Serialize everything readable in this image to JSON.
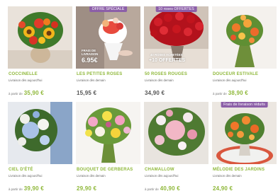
{
  "products": [
    {
      "name": "COCCINELLE",
      "delivery": "Livraison dès aujourd'hui",
      "price_prefix": "à partir de",
      "price": "35,90 €",
      "badge": "",
      "icon": "bouquet-sunflower-photo"
    },
    {
      "name": "LES PETITES ROSES",
      "delivery": "Livraison dès demain",
      "price_prefix": "",
      "price": "15,95 €",
      "badge": "OFFRE SPÉCIALE",
      "overlay_line1": "FRAIS DE",
      "overlay_line2": "LIVRAISON",
      "overlay_big": "6.95€",
      "icon": "bouquet-small-roses-photo"
    },
    {
      "name": "50 ROSES ROUGES",
      "delivery": "Livraison dès demain",
      "price_prefix": "",
      "price": "34,90 €",
      "badge": "10 roses OFFERTES",
      "overlay_line1": "40 ROSES ACHETÉES",
      "overlay_big": "+10 OFFERTES",
      "icon": "bouquet-red-roses-photo"
    },
    {
      "name": "DOUCEUR ESTIVALE",
      "delivery": "Livraison dès aujourd'hui",
      "price_prefix": "à partir de",
      "price": "38,90 €",
      "badge": "",
      "icon": "bouquet-summer-photo"
    },
    {
      "name": "CIEL D'ÉTÉ",
      "delivery": "Livraison dès aujourd'hui",
      "price_prefix": "à partir de",
      "price": "39,90 €",
      "badge": "",
      "icon": "bouquet-blue-hydrangea-photo"
    },
    {
      "name": "BOUQUET DE GERBERAS",
      "delivery": "Livraison dès demain",
      "price_prefix": "",
      "price": "29,90 €",
      "badge": "",
      "icon": "bouquet-gerbera-photo"
    },
    {
      "name": "CHAMALLOW",
      "delivery": "Livraison dès aujourd'hui",
      "price_prefix": "à partir de",
      "price": "40,90 €",
      "badge": "",
      "icon": "bouquet-pink-photo"
    },
    {
      "name": "MÉLODIE DES JARDINS",
      "delivery": "Livraison dès demain",
      "price_prefix": "",
      "price": "24,90 €",
      "badge": "Frais de livraison réduits",
      "icon": "bouquet-orange-roses-photo"
    }
  ],
  "colors": {
    "accent_green": "#8fb83a",
    "badge_purple": "#8c5fa8"
  }
}
